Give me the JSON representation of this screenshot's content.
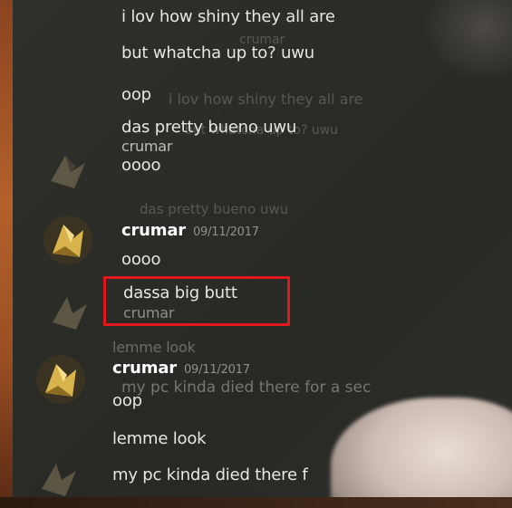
{
  "chat": {
    "messages": {
      "m1": "i lov how shiny they all are",
      "m2": "but whatcha up to? uwu",
      "m3": "oop",
      "m4": "das pretty bueno uwu",
      "m5_author": "crumar",
      "m6": "oooo",
      "g1_author": "crumar",
      "g1_time": "09/11/2017",
      "m7": "oooo",
      "m8": "dassa big butt",
      "m8_under": "crumar",
      "g2_text": "lemme look",
      "g2_author": "crumar",
      "g2_time": "09/11/2017",
      "g2_ghost": "my pc kinda died there for a sec",
      "m9": "oop",
      "m10": "lemme look",
      "m11": "my pc kinda died there f"
    }
  },
  "highlight": {
    "color": "#e0171c",
    "target": "dassa big butt"
  }
}
